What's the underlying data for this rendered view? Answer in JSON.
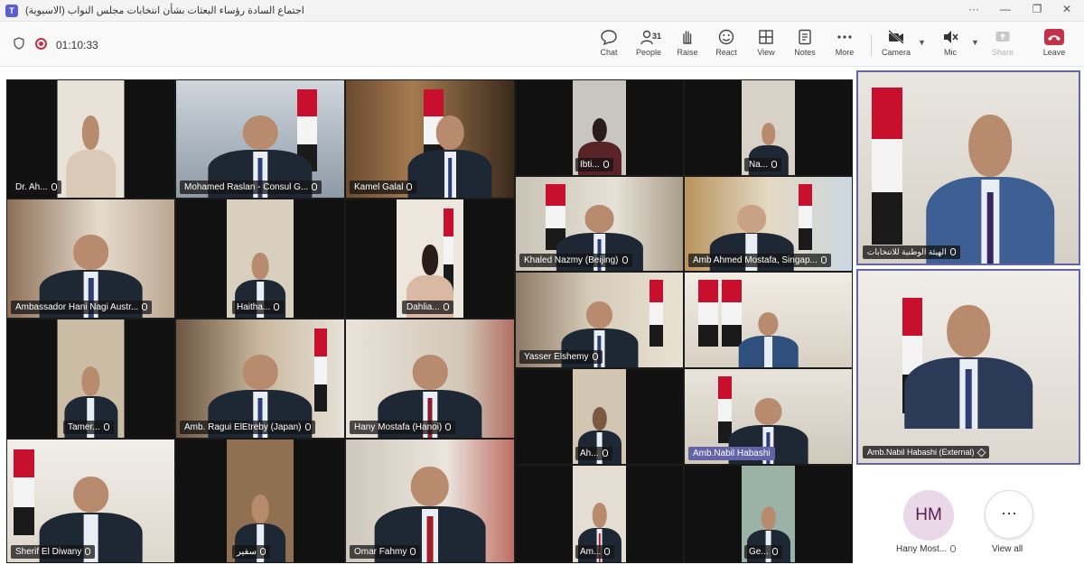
{
  "window": {
    "title": "اجتماع السادة رؤساء البعثات بشأن انتخابات مجلس النواب (الاسيوية)",
    "app_icon": "teams-icon"
  },
  "window_controls": {
    "more": "···",
    "minimize": "—",
    "restore": "❐",
    "close": "✕"
  },
  "meeting": {
    "timer": "01:10:33"
  },
  "toolbar": {
    "chat": "Chat",
    "people": "People",
    "people_count": "31",
    "raise": "Raise",
    "react": "React",
    "view": "View",
    "notes": "Notes",
    "more": "More",
    "camera": "Camera",
    "mic": "Mic",
    "share": "Share",
    "leave": "Leave"
  },
  "colors": {
    "accent": "#6264a7",
    "leave": "#c4314b",
    "flag_red": "#c8102e"
  },
  "participants": [
    {
      "name": "Dr. Ah..."
    },
    {
      "name": "Mohamed Raslan - Consul G..."
    },
    {
      "name": "Kamel Galal"
    },
    {
      "name": "Ibti..."
    },
    {
      "name": "Na..."
    },
    {
      "name": "Ambassador Hani Nagi Austr..."
    },
    {
      "name": "Haitha..."
    },
    {
      "name": "Dahlia..."
    },
    {
      "name": "Khaled Nazmy (Beijing)"
    },
    {
      "name": "Amb Ahmed Mostafa, Singap..."
    },
    {
      "name": "Yasser Elshemy"
    },
    {
      "name": ""
    },
    {
      "name": "Tamer..."
    },
    {
      "name": "Amb. Ragui ElEtreby (Japan)"
    },
    {
      "name": "Hany Mostafa (Hanoi)"
    },
    {
      "name": "Ah..."
    },
    {
      "name": "Amb.Nabil Habashi"
    },
    {
      "name": "Sherif El Diwany"
    },
    {
      "name": "سفير"
    },
    {
      "name": "Omar Fahmy"
    },
    {
      "name": "Am..."
    },
    {
      "name": "Ge..."
    }
  ],
  "sidebar": {
    "spotlight_name": "الهيئة الوطنية للانتخابات",
    "pinned_name": "Amb.Nabil Habashi (External)",
    "roster": {
      "initials": "HM",
      "name": "Hany Most...",
      "view_all": "View all",
      "view_all_glyph": "···"
    }
  }
}
